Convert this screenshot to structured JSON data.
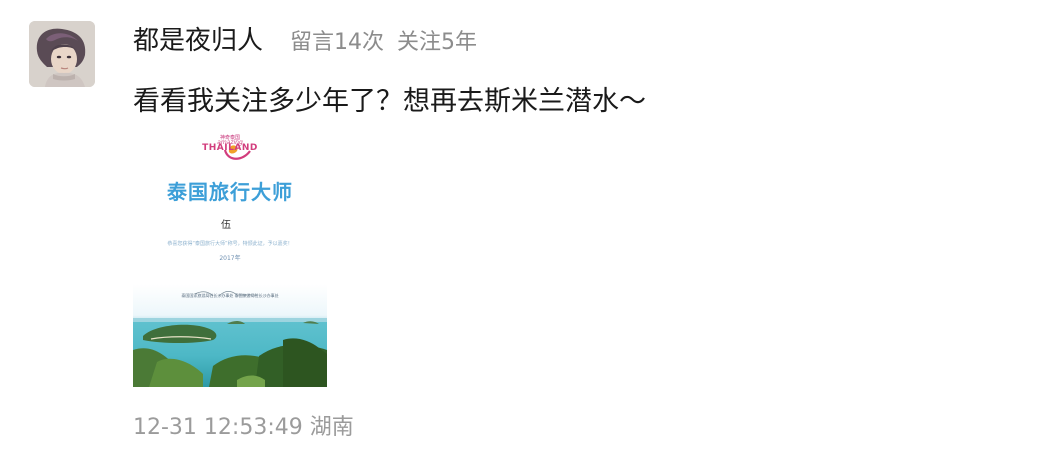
{
  "comment": {
    "author": "都是夜归人",
    "comment_count": "留言14次",
    "follow_years": "关注5年",
    "message": "看看我关注多少年了？想再去斯米兰潜水～",
    "timestamp": "12-31 12:53:49",
    "location": "湖南"
  },
  "certificate": {
    "brand_small": "神奇泰国",
    "brand_amazing": "amazing",
    "brand_thailand": "THAILAND",
    "title": "泰国旅行大师",
    "name": "伍",
    "line": "恭喜您获得“泰国旅行大师”称号，特颁此证，予以嘉奖！",
    "year": "2017年",
    "signer": "泰国国家旅游局驻长沙办事处 泰国旅游局驻长沙办事处"
  },
  "colors": {
    "author_text": "#1a1a1a",
    "meta_text": "#8c8c8c",
    "timestamp_text": "#9b9b9b",
    "certificate_title": "#3d9fd8",
    "brand_accent": "#d23d7d"
  },
  "icons": {
    "avatar": "user-avatar-image"
  }
}
